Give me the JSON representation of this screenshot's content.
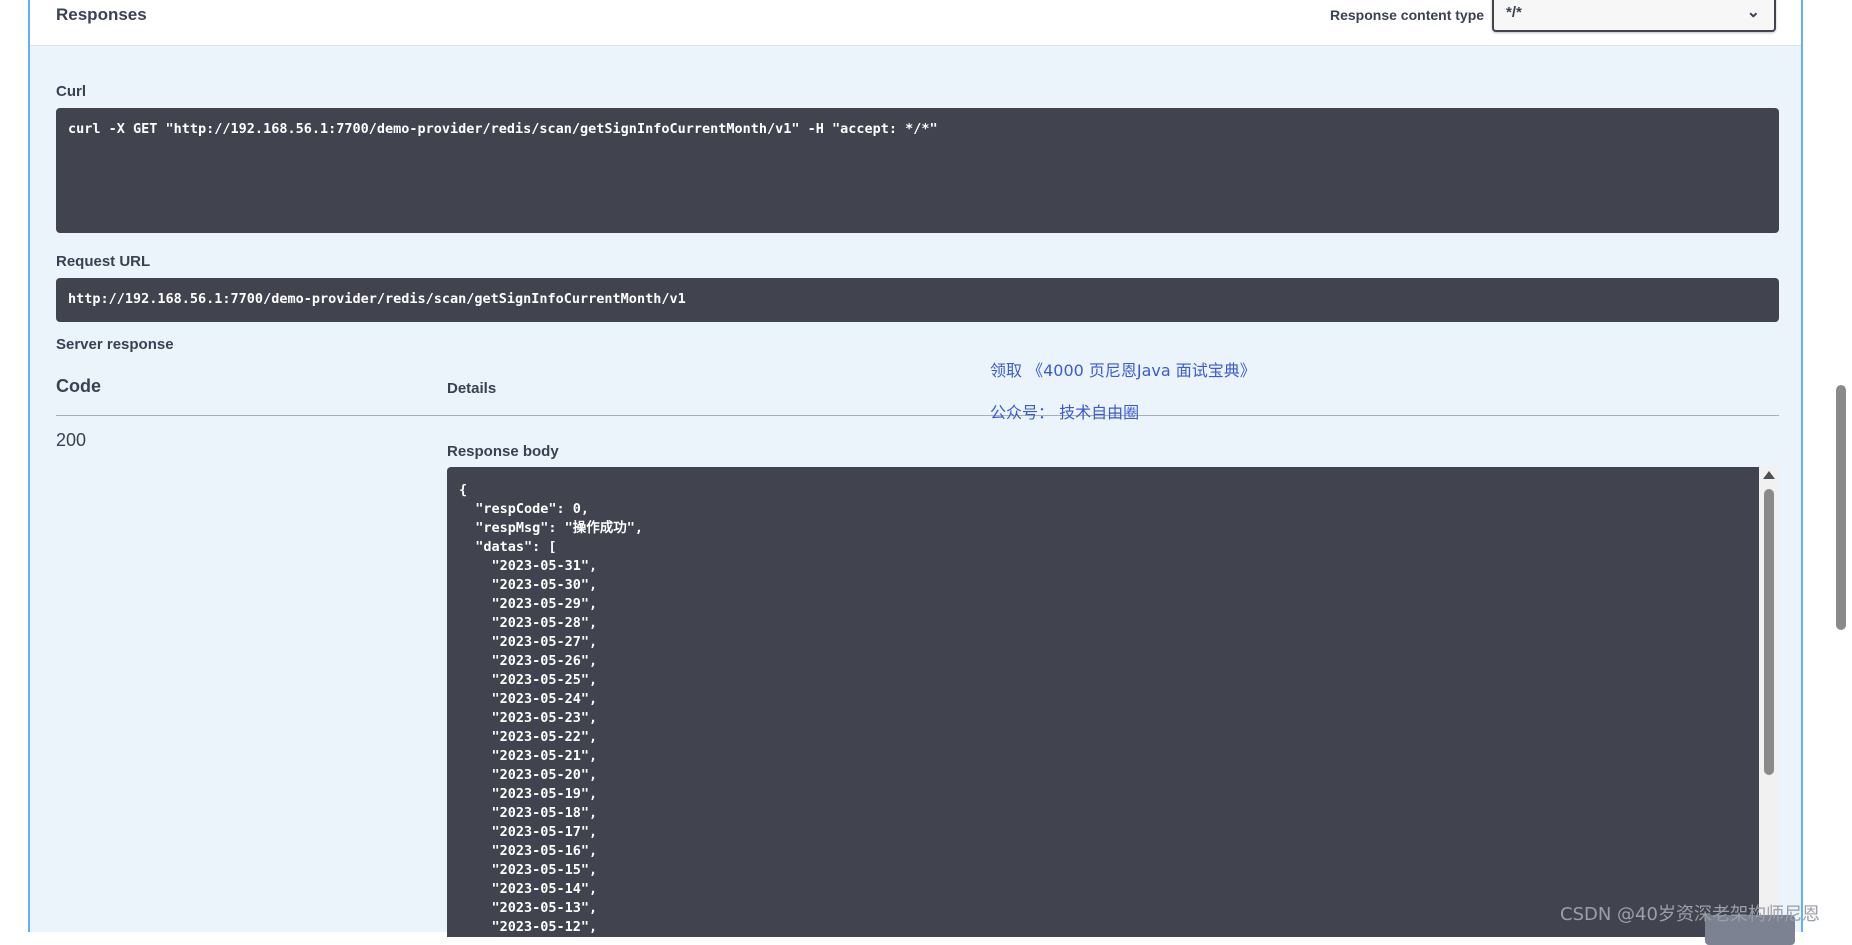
{
  "responses": {
    "title": "Responses",
    "content_type_label": "Response content type",
    "content_type_value": "*/*"
  },
  "curl": {
    "label": "Curl",
    "command": "curl -X GET \"http://192.168.56.1:7700/demo-provider/redis/scan/getSignInfoCurrentMonth/v1\" -H \"accept: */*\""
  },
  "request_url": {
    "label": "Request URL",
    "value": "http://192.168.56.1:7700/demo-provider/redis/scan/getSignInfoCurrentMonth/v1"
  },
  "server_response": {
    "label": "Server response",
    "code_header": "Code",
    "details_header": "Details",
    "status_code": "200",
    "response_body_label": "Response body",
    "body_lines": [
      "{",
      "  \"respCode\": 0,",
      "  \"respMsg\": \"操作成功\",",
      "  \"datas\": [",
      "    \"2023-05-31\",",
      "    \"2023-05-30\",",
      "    \"2023-05-29\",",
      "    \"2023-05-28\",",
      "    \"2023-05-27\",",
      "    \"2023-05-26\",",
      "    \"2023-05-25\",",
      "    \"2023-05-24\",",
      "    \"2023-05-23\",",
      "    \"2023-05-22\",",
      "    \"2023-05-21\",",
      "    \"2023-05-20\",",
      "    \"2023-05-19\",",
      "    \"2023-05-18\",",
      "    \"2023-05-17\",",
      "    \"2023-05-16\",",
      "    \"2023-05-15\",",
      "    \"2023-05-14\",",
      "    \"2023-05-13\",",
      "    \"2023-05-12\","
    ]
  },
  "overlay": {
    "promo_line1": "领取 《4000 页尼恩Java 面试宝典》",
    "promo_line2": "公众号： 技术自由圈",
    "watermark": "CSDN @40岁资深老架构师尼恩"
  },
  "colors": {
    "panel_bg": "#ebf3fb",
    "border": "#61affe",
    "code_bg": "#41444e",
    "promo": "#3b5bd6"
  }
}
